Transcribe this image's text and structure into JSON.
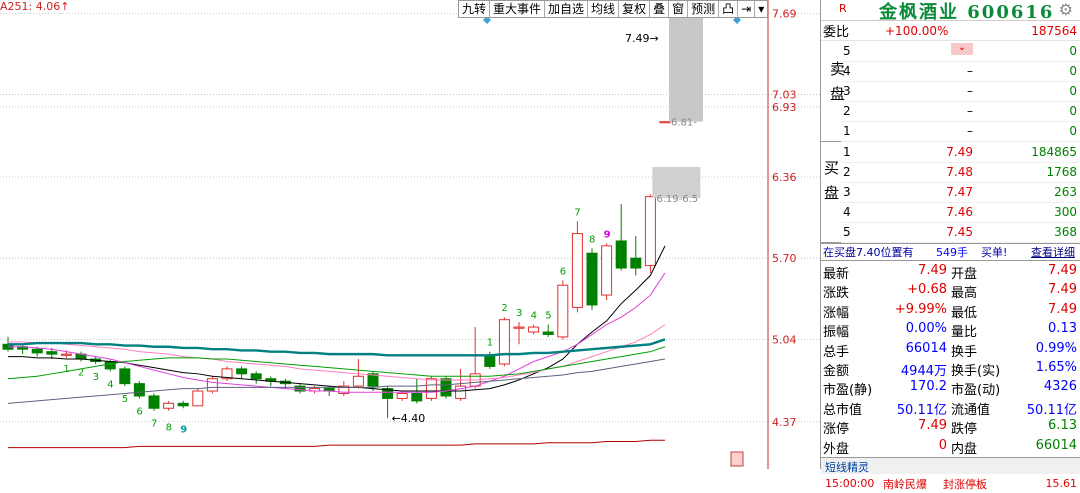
{
  "ma_label": "A251: 4.06↑",
  "toolbar": [
    "九转",
    "重大事件",
    "加自选",
    "均线",
    "复权",
    "叠",
    "窗",
    "预测",
    "凸",
    "⇥",
    "▾"
  ],
  "price_axis": [
    "7.69",
    "7.03",
    "6.93",
    "6.36",
    "5.70",
    "5.04",
    "4.37"
  ],
  "annotations": {
    "high_label": "7.49",
    "low_label": "4.40",
    "gap1": "6.81-",
    "gap2": "6.19-6.5"
  },
  "nine_turn": {
    "down": [
      "1",
      "2",
      "3",
      "4",
      "5",
      "6",
      "7",
      "8",
      "9"
    ],
    "up": [
      "1",
      "2",
      "3",
      "4",
      "5",
      "6",
      "7",
      "8",
      "9"
    ]
  },
  "quote": {
    "marker": "R",
    "name": "金枫酒业 600616",
    "weibi_label": "委比",
    "weibi_pct": "+100.00%",
    "weibi_val": "187564",
    "sell_label": "卖盘",
    "buy_label": "买盘",
    "sells": [
      {
        "lv": "5",
        "price": "",
        "vol": "0"
      },
      {
        "lv": "4",
        "price": "–",
        "vol": "0"
      },
      {
        "lv": "3",
        "price": "–",
        "vol": "0"
      },
      {
        "lv": "2",
        "price": "–",
        "vol": "0"
      },
      {
        "lv": "1",
        "price": "–",
        "vol": "0"
      }
    ],
    "buys": [
      {
        "lv": "1",
        "price": "7.49",
        "vol": "184865"
      },
      {
        "lv": "2",
        "price": "7.48",
        "vol": "1768"
      },
      {
        "lv": "3",
        "price": "7.47",
        "vol": "263"
      },
      {
        "lv": "4",
        "price": "7.46",
        "vol": "300"
      },
      {
        "lv": "5",
        "price": "7.45",
        "vol": "368"
      }
    ],
    "notice": {
      "text": "在买盘7.40位置有",
      "vol": "549手",
      "action": "买单!",
      "link": "查看详细"
    },
    "stats": [
      {
        "l1": "最新",
        "v1": "7.49",
        "l2": "开盘",
        "v2": "7.49"
      },
      {
        "l1": "涨跌",
        "v1": "+0.68",
        "l2": "最高",
        "v2": "7.49"
      },
      {
        "l1": "涨幅",
        "v1": "+9.99%",
        "l2": "最低",
        "v2": "7.49"
      },
      {
        "l1": "振幅",
        "v1": "0.00%",
        "l2": "量比",
        "v2": "0.13"
      },
      {
        "l1": "总手",
        "v1": "66014",
        "l2": "换手",
        "v2": "0.99%"
      },
      {
        "l1": "金额",
        "v1": "4944万",
        "l2": "换手(实)",
        "v2": "1.65%"
      },
      {
        "l1": "市盈(静)",
        "v1": "170.2",
        "l2": "市盈(动)",
        "v2": "4326"
      },
      {
        "l1": "总市值",
        "v1": "50.11亿",
        "l2": "流通值",
        "v2": "50.11亿"
      },
      {
        "l1": "涨停",
        "v1": "7.49",
        "l2": "跌停",
        "v2": "6.13"
      },
      {
        "l1": "外盘",
        "v1": "0",
        "l2": "内盘",
        "v2": "66014"
      }
    ],
    "sprite_title": "短线精灵",
    "sprite_row": {
      "time": "15:00:00",
      "name": "南岭民爆",
      "event": "封涨停板",
      "value": "15.61"
    }
  },
  "chart_data": {
    "type": "candlestick",
    "price_range": [
      4.1,
      7.75
    ],
    "candles": [
      {
        "o": 5.0,
        "c": 4.96,
        "h": 5.06,
        "l": 4.94
      },
      {
        "o": 4.98,
        "c": 4.96,
        "h": 5.0,
        "l": 4.92
      },
      {
        "o": 4.96,
        "c": 4.93,
        "h": 4.98,
        "l": 4.9
      },
      {
        "o": 4.94,
        "c": 4.92,
        "h": 4.97,
        "l": 4.88
      },
      {
        "o": 4.92,
        "c": 4.92,
        "h": 4.95,
        "l": 4.89
      },
      {
        "o": 4.92,
        "c": 4.88,
        "h": 4.94,
        "l": 4.86
      },
      {
        "o": 4.88,
        "c": 4.86,
        "h": 4.9,
        "l": 4.84
      },
      {
        "o": 4.86,
        "c": 4.8,
        "h": 4.88,
        "l": 4.78
      },
      {
        "o": 4.8,
        "c": 4.68,
        "h": 4.82,
        "l": 4.66
      },
      {
        "o": 4.68,
        "c": 4.58,
        "h": 4.7,
        "l": 4.56
      },
      {
        "o": 4.58,
        "c": 4.48,
        "h": 4.6,
        "l": 4.46
      },
      {
        "o": 4.48,
        "c": 4.52,
        "h": 4.54,
        "l": 4.46
      },
      {
        "o": 4.52,
        "c": 4.5,
        "h": 4.54,
        "l": 4.48
      },
      {
        "o": 4.5,
        "c": 4.62,
        "h": 4.64,
        "l": 4.5
      },
      {
        "o": 4.62,
        "c": 4.72,
        "h": 4.74,
        "l": 4.6
      },
      {
        "o": 4.72,
        "c": 4.8,
        "h": 4.82,
        "l": 4.7
      },
      {
        "o": 4.8,
        "c": 4.76,
        "h": 4.82,
        "l": 4.72
      },
      {
        "o": 4.76,
        "c": 4.72,
        "h": 4.78,
        "l": 4.68
      },
      {
        "o": 4.72,
        "c": 4.7,
        "h": 4.74,
        "l": 4.66
      },
      {
        "o": 4.7,
        "c": 4.68,
        "h": 4.72,
        "l": 4.64
      },
      {
        "o": 4.66,
        "c": 4.62,
        "h": 4.68,
        "l": 4.6
      },
      {
        "o": 4.62,
        "c": 4.64,
        "h": 4.66,
        "l": 4.6
      },
      {
        "o": 4.64,
        "c": 4.62,
        "h": 4.66,
        "l": 4.58
      },
      {
        "o": 4.6,
        "c": 4.66,
        "h": 4.7,
        "l": 4.58
      },
      {
        "o": 4.66,
        "c": 4.74,
        "h": 4.88,
        "l": 4.64
      },
      {
        "o": 4.76,
        "c": 4.66,
        "h": 4.78,
        "l": 4.62
      },
      {
        "o": 4.64,
        "c": 4.56,
        "h": 4.66,
        "l": 4.4
      },
      {
        "o": 4.56,
        "c": 4.6,
        "h": 4.62,
        "l": 4.54
      },
      {
        "o": 4.6,
        "c": 4.54,
        "h": 4.72,
        "l": 4.52
      },
      {
        "o": 4.56,
        "c": 4.72,
        "h": 4.74,
        "l": 4.54
      },
      {
        "o": 4.72,
        "c": 4.58,
        "h": 4.74,
        "l": 4.56
      },
      {
        "o": 4.56,
        "c": 4.66,
        "h": 4.8,
        "l": 4.54
      },
      {
        "o": 4.66,
        "c": 4.76,
        "h": 5.14,
        "l": 4.64
      },
      {
        "o": 4.9,
        "c": 4.82,
        "h": 4.94,
        "l": 4.8
      },
      {
        "o": 4.84,
        "c": 5.2,
        "h": 5.22,
        "l": 4.82
      },
      {
        "o": 5.14,
        "c": 5.14,
        "h": 5.18,
        "l": 5.0
      },
      {
        "o": 5.1,
        "c": 5.14,
        "h": 5.16,
        "l": 5.08
      },
      {
        "o": 5.1,
        "c": 5.08,
        "h": 5.16,
        "l": 5.06
      },
      {
        "o": 5.06,
        "c": 5.48,
        "h": 5.52,
        "l": 5.04
      },
      {
        "o": 5.3,
        "c": 5.9,
        "h": 6.0,
        "l": 5.26
      },
      {
        "o": 5.74,
        "c": 5.32,
        "h": 5.78,
        "l": 5.28
      },
      {
        "o": 5.4,
        "c": 5.8,
        "h": 5.82,
        "l": 5.36
      },
      {
        "o": 5.84,
        "c": 5.62,
        "h": 6.14,
        "l": 5.6
      },
      {
        "o": 5.7,
        "c": 5.62,
        "h": 5.88,
        "l": 5.56
      },
      {
        "o": 5.64,
        "c": 6.2,
        "h": 6.22,
        "l": 5.58
      },
      {
        "o": 6.81,
        "c": 6.81,
        "h": 6.81,
        "l": 6.81
      }
    ],
    "ma_series": [
      {
        "color": "#000000",
        "values": [
          4.9,
          4.9,
          4.89,
          4.89,
          4.88,
          4.88,
          4.87,
          4.86,
          4.85,
          4.83,
          4.81,
          4.79,
          4.77,
          4.76,
          4.74,
          4.73,
          4.72,
          4.71,
          4.7,
          4.69,
          4.68,
          4.67,
          4.66,
          4.65,
          4.65,
          4.64,
          4.63,
          4.62,
          4.62,
          4.62,
          4.62,
          4.62,
          4.63,
          4.64,
          4.67,
          4.71,
          4.76,
          4.81,
          4.88,
          5.0,
          5.1,
          5.19,
          5.33,
          5.44,
          5.56,
          5.8
        ]
      },
      {
        "color": "#e040e0",
        "values": [
          4.98,
          4.98,
          4.97,
          4.96,
          4.94,
          4.92,
          4.9,
          4.88,
          4.85,
          4.82,
          4.79,
          4.76,
          4.73,
          4.71,
          4.69,
          4.68,
          4.67,
          4.66,
          4.65,
          4.64,
          4.63,
          4.62,
          4.62,
          4.61,
          4.61,
          4.61,
          4.61,
          4.61,
          4.61,
          4.61,
          4.62,
          4.64,
          4.66,
          4.7,
          4.74,
          4.8,
          4.86,
          4.9,
          4.94,
          5.0,
          5.08,
          5.16,
          5.22,
          5.3,
          5.4,
          5.58
        ]
      },
      {
        "color": "#ff80c0",
        "values": [
          5.02,
          5.02,
          5.01,
          5.01,
          5.0,
          4.99,
          4.98,
          4.97,
          4.96,
          4.94,
          4.93,
          4.92,
          4.9,
          4.89,
          4.88,
          4.86,
          4.85,
          4.84,
          4.83,
          4.82,
          4.8,
          4.79,
          4.78,
          4.77,
          4.76,
          4.75,
          4.74,
          4.73,
          4.72,
          4.71,
          4.71,
          4.71,
          4.71,
          4.72,
          4.73,
          4.75,
          4.77,
          4.8,
          4.82,
          4.86,
          4.9,
          4.94,
          4.98,
          5.02,
          5.08,
          5.16
        ]
      },
      {
        "color": "#008080",
        "values": [
          5.0,
          5.0,
          5.01,
          5.01,
          5.01,
          5.01,
          5.0,
          5.0,
          4.99,
          4.99,
          4.98,
          4.98,
          4.97,
          4.97,
          4.96,
          4.96,
          4.95,
          4.95,
          4.94,
          4.94,
          4.93,
          4.93,
          4.92,
          4.92,
          4.92,
          4.92,
          4.91,
          4.91,
          4.91,
          4.91,
          4.91,
          4.91,
          4.91,
          4.91,
          4.92,
          4.92,
          4.93,
          4.93,
          4.94,
          4.95,
          4.96,
          4.97,
          4.98,
          4.99,
          5.0,
          5.04
        ]
      },
      {
        "color": "#00a000",
        "values": [
          4.72,
          4.73,
          4.74,
          4.76,
          4.78,
          4.8,
          4.82,
          4.84,
          4.86,
          4.87,
          4.88,
          4.89,
          4.89,
          4.89,
          4.88,
          4.88,
          4.87,
          4.86,
          4.85,
          4.84,
          4.83,
          4.82,
          4.81,
          4.8,
          4.79,
          4.78,
          4.77,
          4.76,
          4.75,
          4.74,
          4.74,
          4.74,
          4.74,
          4.74,
          4.75,
          4.76,
          4.78,
          4.8,
          4.82,
          4.84,
          4.86,
          4.88,
          4.9,
          4.92,
          4.94,
          4.98
        ]
      },
      {
        "color": "#606080",
        "values": [
          4.52,
          4.53,
          4.54,
          4.55,
          4.56,
          4.57,
          4.58,
          4.59,
          4.6,
          4.61,
          4.62,
          4.63,
          4.64,
          4.64,
          4.65,
          4.65,
          4.65,
          4.65,
          4.65,
          4.65,
          4.65,
          4.65,
          4.65,
          4.65,
          4.65,
          4.65,
          4.66,
          4.66,
          4.66,
          4.67,
          4.67,
          4.68,
          4.69,
          4.7,
          4.71,
          4.72,
          4.73,
          4.74,
          4.75,
          4.77,
          4.78,
          4.8,
          4.82,
          4.84,
          4.86,
          4.88
        ]
      },
      {
        "color": "#b00000",
        "values": [
          4.16,
          4.16,
          4.16,
          4.16,
          4.16,
          4.16,
          4.16,
          4.16,
          4.16,
          4.17,
          4.17,
          4.17,
          4.17,
          4.17,
          4.17,
          4.17,
          4.17,
          4.17,
          4.17,
          4.17,
          4.17,
          4.17,
          4.18,
          4.18,
          4.18,
          4.18,
          4.18,
          4.18,
          4.18,
          4.18,
          4.18,
          4.18,
          4.19,
          4.19,
          4.19,
          4.19,
          4.19,
          4.2,
          4.2,
          4.2,
          4.2,
          4.21,
          4.21,
          4.21,
          4.22,
          4.22
        ]
      }
    ]
  }
}
